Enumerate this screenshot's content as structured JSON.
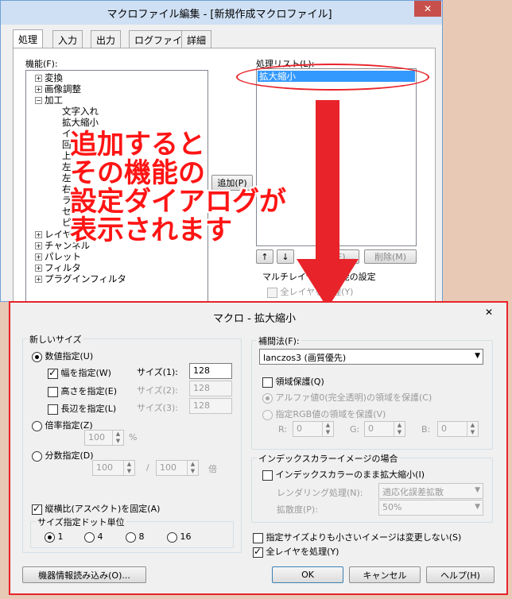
{
  "back_window": {
    "title": "マクロファイル編集 - [新規作成マクロファイル]",
    "close_label": "✕",
    "tabs": [
      "処理",
      "入力",
      "出力",
      "ログファイル",
      "詳細"
    ],
    "function_label": "機能(F):",
    "tree": [
      {
        "label": "変換",
        "expander": "+"
      },
      {
        "label": "画像調整",
        "expander": "+"
      },
      {
        "label": "加工",
        "expander": "−"
      },
      {
        "label": "文字入れ"
      },
      {
        "label": "拡大縮小"
      },
      {
        "label": "イ"
      },
      {
        "label": "回"
      },
      {
        "label": "上"
      },
      {
        "label": "左"
      },
      {
        "label": "左"
      },
      {
        "label": "右"
      },
      {
        "label": "ラ"
      },
      {
        "label": "セ"
      },
      {
        "label": "ピ"
      },
      {
        "label": "レイヤ",
        "expander": "+"
      },
      {
        "label": "チャンネル",
        "expander": "+"
      },
      {
        "label": "パレット",
        "expander": "+"
      },
      {
        "label": "フィルタ",
        "expander": "+"
      },
      {
        "label": "プラグインフィルタ",
        "expander": "+"
      }
    ],
    "add_button": "追加(P)",
    "process_list_label": "処理リスト(L):",
    "process_list": [
      "拡大縮小"
    ],
    "up_arrow": "↑",
    "down_arrow": "↓",
    "edit_button": "(E)...",
    "delete_button": "削除(M)",
    "multilayer_label": "マルチレイヤ対応機能の設定",
    "all_layers_label": "全レイヤを処理(Y)"
  },
  "annotation": {
    "lines": [
      "追加すると",
      "その機能の",
      "設定ダイアログが",
      "表示されます"
    ],
    "color": "#ff1414"
  },
  "dialog": {
    "title": "マクロ - 拡大縮小",
    "close_label": "✕",
    "new_size": {
      "label": "新しいサイズ",
      "numeric_label": "数値指定(U)",
      "width_label": "幅を指定(W)",
      "height_label": "高さを指定(E)",
      "long_side_label": "長辺を指定(L)",
      "size1_label": "サイズ(1):",
      "size2_label": "サイズ(2):",
      "size3_label": "サイズ(3):",
      "size1_value": "128",
      "size2_value": "128",
      "size3_value": "128",
      "ratio_label": "倍率指定(Z)",
      "ratio_value": "100",
      "ratio_unit": "%",
      "fraction_label": "分数指定(D)",
      "fraction_num": "100",
      "fraction_sep": "/",
      "fraction_den": "100",
      "fraction_unit": "倍",
      "aspect_label": "縦横比(アスペクト)を固定(A)",
      "dot_unit_label": "サイズ指定ドット単位",
      "dot_options": [
        "1",
        "4",
        "8",
        "16"
      ]
    },
    "interp": {
      "label": "補間法(F):",
      "value": "lanczos3 (画質優先)"
    },
    "region_protect_label": "領域保護(Q)",
    "alpha_protect_label": "アルファ値0(完全透明)の領域を保護(C)",
    "rgb_protect_label": "指定RGB値の領域を保護(V)",
    "rgb": {
      "r_label": "R:",
      "g_label": "G:",
      "b_label": "B:",
      "r": "0",
      "g": "0",
      "b": "0"
    },
    "index_group_label": "インデックスカラーイメージの場合",
    "index_keep_label": "インデックスカラーのまま拡大縮小(I)",
    "rendering_label": "レンダリング処理(N):",
    "rendering_value": "適応化誤差拡散",
    "diffusion_label": "拡散度(P):",
    "diffusion_value": "50%",
    "no_shrink_label": "指定サイズよりも小さいイメージは変更しない(S)",
    "all_layers_label": "全レイヤを処理(Y)",
    "device_button": "機器情報読み込み(O)...",
    "ok_button": "OK",
    "cancel_button": "キャンセル",
    "help_button": "ヘルプ(H)"
  }
}
